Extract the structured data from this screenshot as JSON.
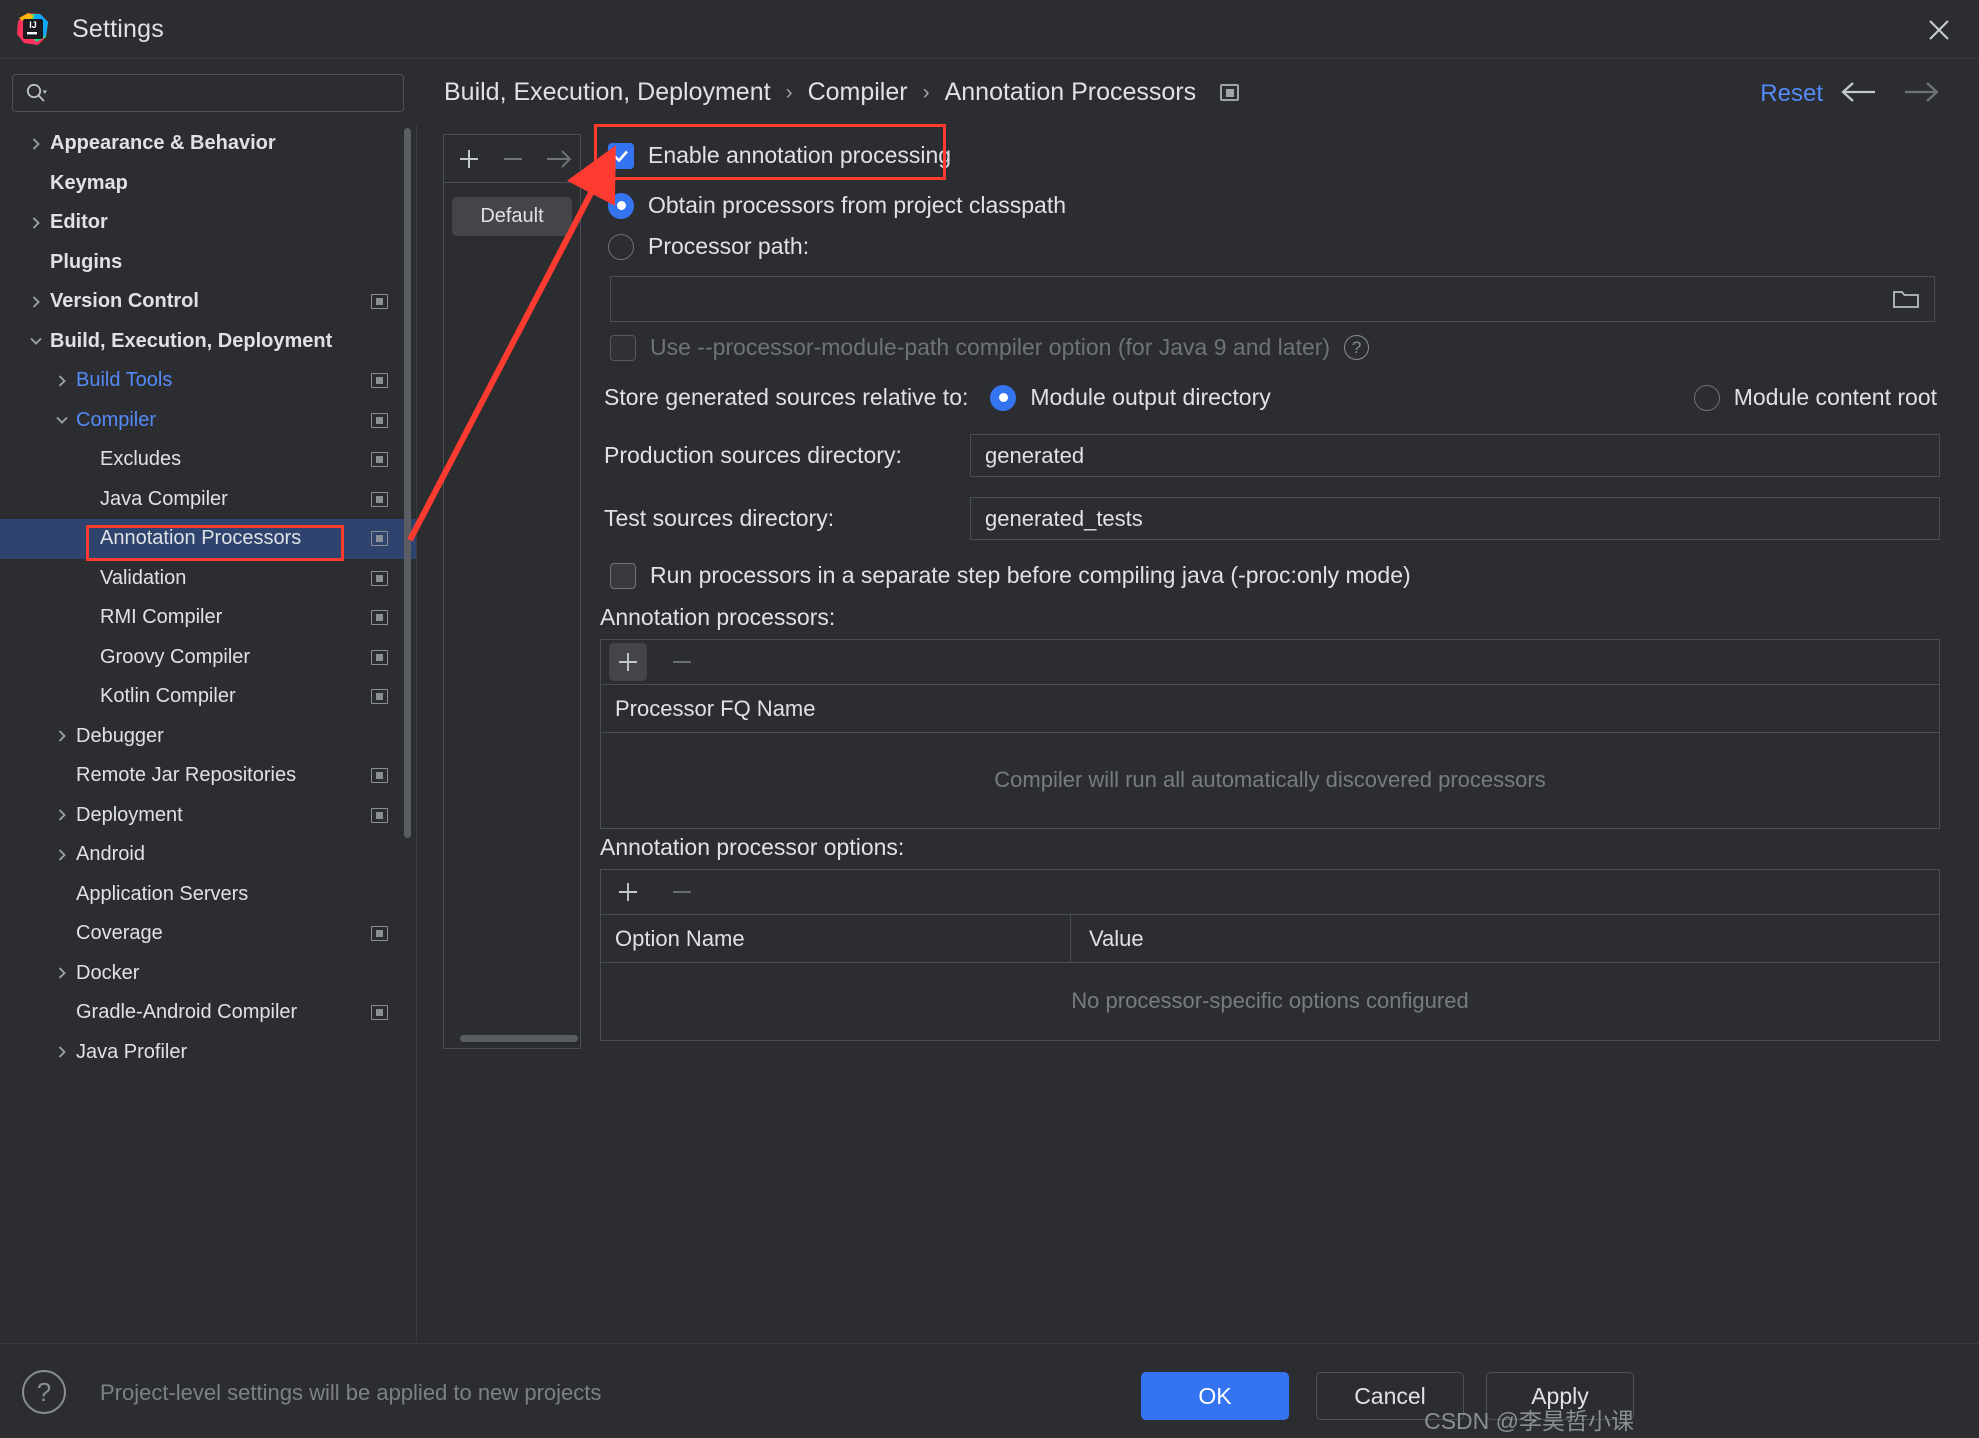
{
  "window": {
    "title": "Settings",
    "logo_icon": "intellij-idea-logo",
    "close_icon": "close-icon"
  },
  "search": {
    "placeholder": "",
    "value": "",
    "icon": "search-icon"
  },
  "sidebar": {
    "items": [
      {
        "label": "Appearance & Behavior",
        "indent": 0,
        "arrow": "chevron-right",
        "bold": true,
        "blue": false,
        "badge": false,
        "selected": false
      },
      {
        "label": "Keymap",
        "indent": 0,
        "arrow": "",
        "bold": true,
        "blue": false,
        "badge": false,
        "selected": false
      },
      {
        "label": "Editor",
        "indent": 0,
        "arrow": "chevron-right",
        "bold": true,
        "blue": false,
        "badge": false,
        "selected": false
      },
      {
        "label": "Plugins",
        "indent": 0,
        "arrow": "",
        "bold": true,
        "blue": false,
        "badge": false,
        "selected": false
      },
      {
        "label": "Version Control",
        "indent": 0,
        "arrow": "chevron-right",
        "bold": true,
        "blue": false,
        "badge": true,
        "selected": false
      },
      {
        "label": "Build, Execution, Deployment",
        "indent": 0,
        "arrow": "chevron-down",
        "bold": true,
        "blue": false,
        "badge": false,
        "selected": false
      },
      {
        "label": "Build Tools",
        "indent": 1,
        "arrow": "chevron-right",
        "bold": false,
        "blue": true,
        "badge": true,
        "selected": false
      },
      {
        "label": "Compiler",
        "indent": 1,
        "arrow": "chevron-down",
        "bold": false,
        "blue": true,
        "badge": true,
        "selected": false
      },
      {
        "label": "Excludes",
        "indent": 2,
        "arrow": "",
        "bold": false,
        "blue": false,
        "badge": true,
        "selected": false
      },
      {
        "label": "Java Compiler",
        "indent": 2,
        "arrow": "",
        "bold": false,
        "blue": false,
        "badge": true,
        "selected": false
      },
      {
        "label": "Annotation Processors",
        "indent": 2,
        "arrow": "",
        "bold": false,
        "blue": false,
        "badge": true,
        "selected": true
      },
      {
        "label": "Validation",
        "indent": 2,
        "arrow": "",
        "bold": false,
        "blue": false,
        "badge": true,
        "selected": false
      },
      {
        "label": "RMI Compiler",
        "indent": 2,
        "arrow": "",
        "bold": false,
        "blue": false,
        "badge": true,
        "selected": false
      },
      {
        "label": "Groovy Compiler",
        "indent": 2,
        "arrow": "",
        "bold": false,
        "blue": false,
        "badge": true,
        "selected": false
      },
      {
        "label": "Kotlin Compiler",
        "indent": 2,
        "arrow": "",
        "bold": false,
        "blue": false,
        "badge": true,
        "selected": false
      },
      {
        "label": "Debugger",
        "indent": 1,
        "arrow": "chevron-right",
        "bold": false,
        "blue": false,
        "badge": false,
        "selected": false
      },
      {
        "label": "Remote Jar Repositories",
        "indent": 1,
        "arrow": "",
        "bold": false,
        "blue": false,
        "badge": true,
        "selected": false
      },
      {
        "label": "Deployment",
        "indent": 1,
        "arrow": "chevron-right",
        "bold": false,
        "blue": false,
        "badge": true,
        "selected": false
      },
      {
        "label": "Android",
        "indent": 1,
        "arrow": "chevron-right",
        "bold": false,
        "blue": false,
        "badge": false,
        "selected": false
      },
      {
        "label": "Application Servers",
        "indent": 1,
        "arrow": "",
        "bold": false,
        "blue": false,
        "badge": false,
        "selected": false
      },
      {
        "label": "Coverage",
        "indent": 1,
        "arrow": "",
        "bold": false,
        "blue": false,
        "badge": true,
        "selected": false
      },
      {
        "label": "Docker",
        "indent": 1,
        "arrow": "chevron-right",
        "bold": false,
        "blue": false,
        "badge": false,
        "selected": false
      },
      {
        "label": "Gradle-Android Compiler",
        "indent": 1,
        "arrow": "",
        "bold": false,
        "blue": false,
        "badge": true,
        "selected": false
      },
      {
        "label": "Java Profiler",
        "indent": 1,
        "arrow": "chevron-right",
        "bold": false,
        "blue": false,
        "badge": false,
        "selected": false
      }
    ]
  },
  "header": {
    "breadcrumb": [
      "Build, Execution, Deployment",
      "Compiler",
      "Annotation Processors"
    ],
    "separator": "›",
    "badge_icon": "project-scope-icon",
    "reset_label": "Reset",
    "back_icon": "arrow-left-icon",
    "forward_icon": "arrow-right-icon"
  },
  "modules": {
    "add_icon": "plus-icon",
    "remove_icon": "minus-icon",
    "move_icon": "arrow-right-icon",
    "items": [
      "Default"
    ]
  },
  "main": {
    "enable_annotation_processing": {
      "label": "Enable annotation processing",
      "checked": true
    },
    "processor_source": {
      "selected": "classpath",
      "options": [
        {
          "id": "classpath",
          "label": "Obtain processors from project classpath"
        },
        {
          "id": "path",
          "label": "Processor path:"
        }
      ]
    },
    "processor_path": {
      "value": "",
      "folder_icon": "folder-icon"
    },
    "use_module_path": {
      "label": "Use --processor-module-path compiler option (for Java 9 and later)",
      "checked": false,
      "disabled": true,
      "help_icon": "question-mark-icon"
    },
    "store_sources": {
      "label": "Store generated sources relative to:",
      "selected": "module_output",
      "options": [
        {
          "id": "module_output",
          "label": "Module output directory"
        },
        {
          "id": "module_content",
          "label": "Module content root"
        }
      ]
    },
    "production_sources": {
      "label": "Production sources directory:",
      "value": "generated"
    },
    "test_sources": {
      "label": "Test sources directory:",
      "value": "generated_tests"
    },
    "separate_step": {
      "label": "Run processors in a separate step before compiling java (-proc:only mode)",
      "checked": false
    },
    "annotation_processors": {
      "section_label": "Annotation processors:",
      "add_icon": "plus-icon",
      "remove_icon": "minus-icon",
      "columns": [
        "Processor FQ Name"
      ],
      "empty_text": "Compiler will run all automatically discovered processors",
      "rows": []
    },
    "annotation_processor_options": {
      "section_label": "Annotation processor options:",
      "add_icon": "plus-icon",
      "remove_icon": "minus-icon",
      "columns": [
        "Option Name",
        "Value"
      ],
      "empty_text": "No processor-specific options configured",
      "rows": []
    }
  },
  "footer": {
    "help_icon": "question-mark-icon",
    "note": "Project-level settings will be applied to new projects",
    "ok_label": "OK",
    "cancel_label": "Cancel",
    "apply_label": "Apply",
    "watermark": "CSDN @李昊哲小课"
  },
  "annotations": {
    "accent_color": "#ff3b30",
    "highlight_selected_tree_item": true,
    "highlight_enable_checkbox": true
  }
}
